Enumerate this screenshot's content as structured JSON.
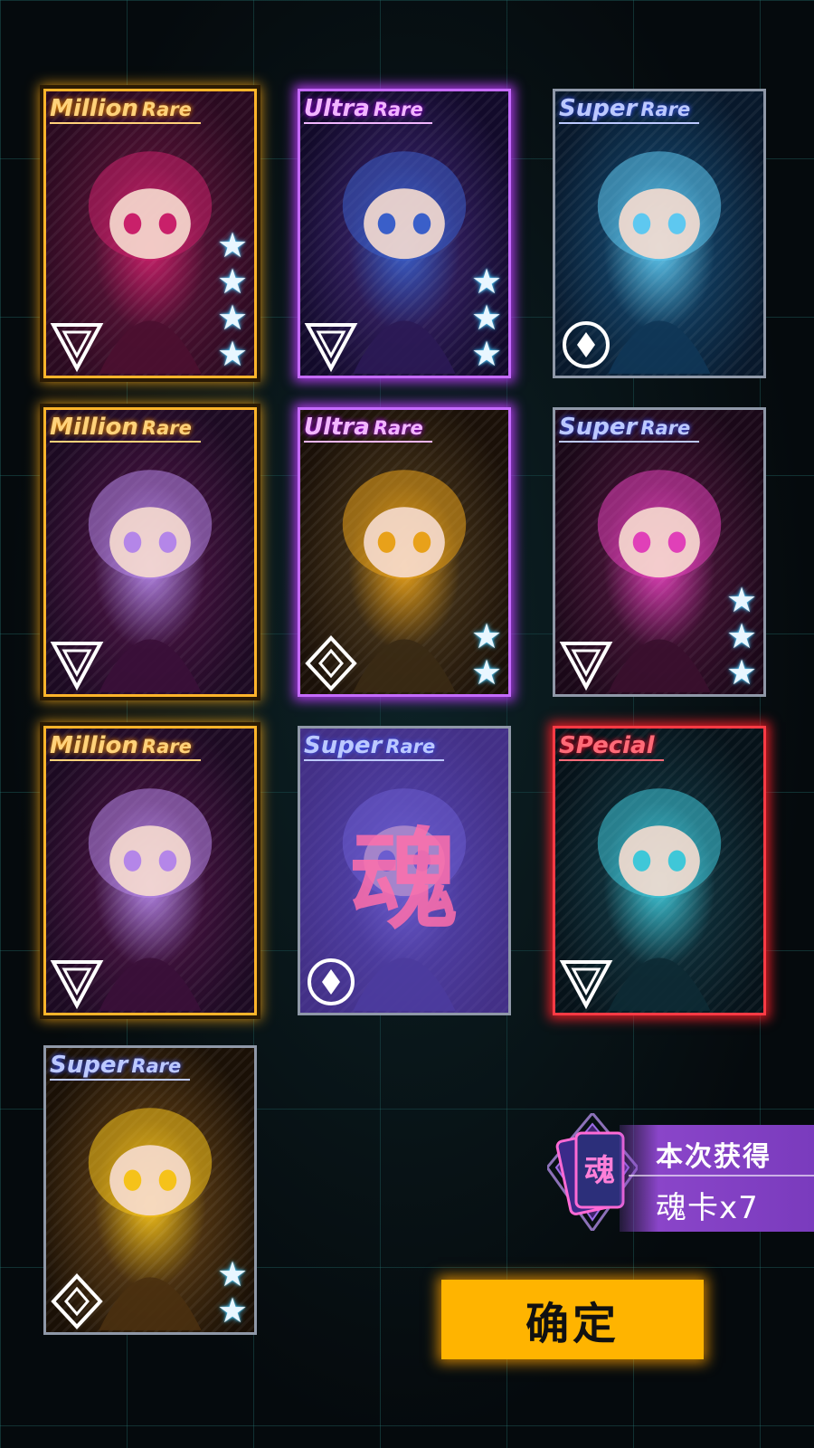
{
  "cards": [
    {
      "rarity_main": "Million",
      "rarity_sub": "Rare",
      "tier": "million",
      "stars": 4,
      "emblem": "triangle-emblem",
      "palette": [
        "#4b1030",
        "#2a0a20",
        "#c9206a"
      ],
      "soul": false
    },
    {
      "rarity_main": "Ultra",
      "rarity_sub": "Rare",
      "tier": "ultra",
      "stars": 3,
      "emblem": "triangle-emblem",
      "palette": [
        "#2b1a55",
        "#120a2a",
        "#3a5fc9"
      ],
      "soul": false
    },
    {
      "rarity_main": "Super",
      "rarity_sub": "Rare",
      "tier": "super",
      "stars": 0,
      "emblem": "circle-diamond-emblem",
      "palette": [
        "#0f3656",
        "#08182b",
        "#5ec8f0"
      ],
      "soul": false
    },
    {
      "rarity_main": "Million",
      "rarity_sub": "Rare",
      "tier": "million",
      "stars": 0,
      "emblem": "triangle-emblem",
      "palette": [
        "#3a1038",
        "#1c0a22",
        "#b486e8"
      ],
      "soul": false
    },
    {
      "rarity_main": "Ultra",
      "rarity_sub": "Rare",
      "tier": "ultra",
      "stars": 2,
      "emblem": "diamond-emblem",
      "palette": [
        "#3a2a14",
        "#1a1008",
        "#e8a11a"
      ],
      "soul": false
    },
    {
      "rarity_main": "Super",
      "rarity_sub": "Rare",
      "tier": "super",
      "stars": 3,
      "emblem": "triangle-emblem",
      "palette": [
        "#3a102e",
        "#1a0818",
        "#e040b8"
      ],
      "soul": false
    },
    {
      "rarity_main": "Million",
      "rarity_sub": "Rare",
      "tier": "million",
      "stars": 0,
      "emblem": "triangle-emblem",
      "palette": [
        "#3a1038",
        "#1c0a22",
        "#b486e8"
      ],
      "soul": false
    },
    {
      "rarity_main": "Super",
      "rarity_sub": "Rare",
      "tier": "super",
      "stars": 0,
      "emblem": "circle-diamond-emblem",
      "palette": [
        "#24306a",
        "#101838",
        "#6a7ad8"
      ],
      "soul": true,
      "soul_label": "魂"
    },
    {
      "rarity_main": "SPecial",
      "rarity_sub": "",
      "tier": "special",
      "stars": 0,
      "emblem": "triangle-emblem",
      "palette": [
        "#0d2a34",
        "#061219",
        "#3fc7d8"
      ],
      "soul": false
    },
    {
      "rarity_main": "Super",
      "rarity_sub": "Rare",
      "tier": "super",
      "stars": 2,
      "emblem": "diamond-emblem",
      "palette": [
        "#4a3010",
        "#1a1006",
        "#f5c21a"
      ],
      "soul": false
    }
  ],
  "reward": {
    "title": "本次获得",
    "count": "魂卡x7",
    "icon_label": "魂"
  },
  "confirm_label": "确定"
}
